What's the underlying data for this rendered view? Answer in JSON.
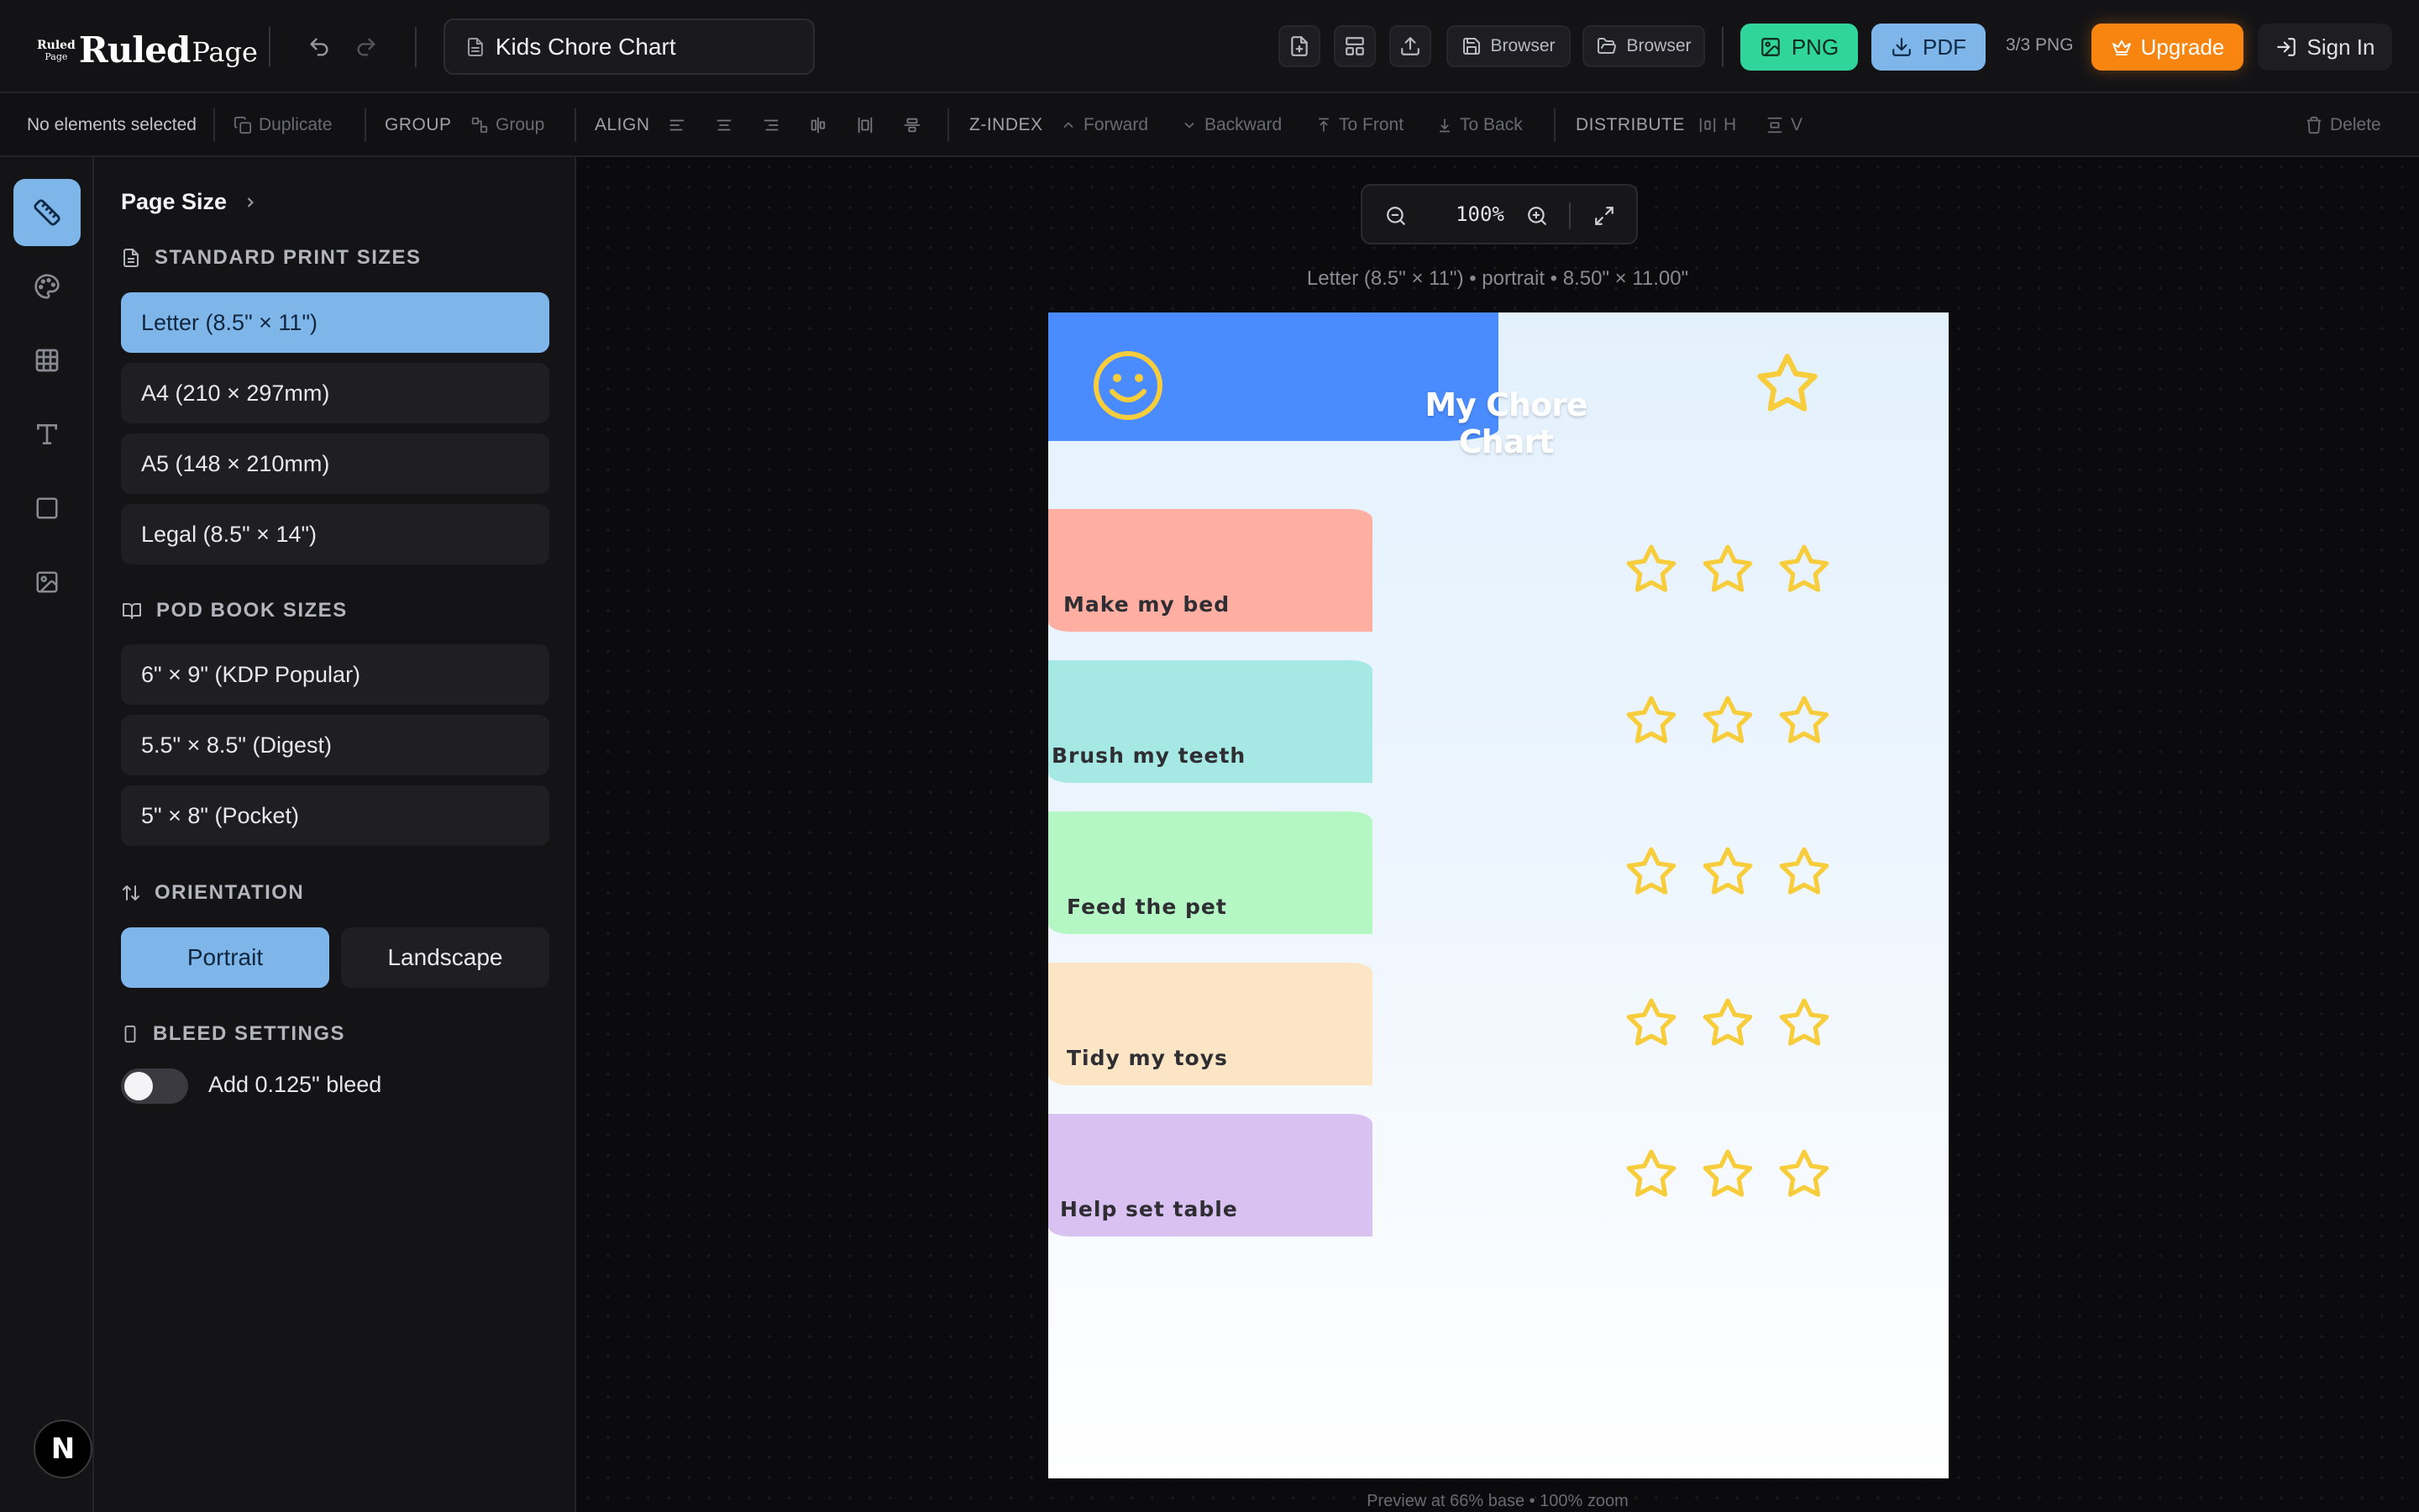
{
  "app": {
    "logo": {
      "mini_top": "Ruled",
      "mini_bottom": "Page",
      "main": "Ruled",
      "suffix": "Page"
    },
    "document_title": "Kids Chore Chart",
    "toolbar": {
      "save_browser_label": "Browser",
      "open_browser_label": "Browser",
      "png_label": "PNG",
      "pdf_label": "PDF",
      "png_count": "3/3 PNG",
      "upgrade_label": "Upgrade",
      "signin_label": "Sign In"
    },
    "colors": {
      "accent_blue": "#7fb6ea",
      "png_green": "#2fd59a",
      "upgrade_orange": "#f7850f"
    }
  },
  "edit_bar": {
    "status": "No elements selected",
    "duplicate": "Duplicate",
    "group_label": "GROUP",
    "group": "Group",
    "align_label": "ALIGN",
    "zindex_label": "Z-INDEX",
    "forward": "Forward",
    "backward": "Backward",
    "to_front": "To Front",
    "to_back": "To Back",
    "distribute_label": "DISTRIBUTE",
    "dist_h": "H",
    "dist_v": "V",
    "delete": "Delete"
  },
  "panel": {
    "title": "Page Size",
    "standard_heading": "STANDARD PRINT SIZES",
    "standard_sizes": [
      {
        "label": "Letter (8.5\" × 11\")",
        "selected": true
      },
      {
        "label": "A4 (210 × 297mm)",
        "selected": false
      },
      {
        "label": "A5 (148 × 210mm)",
        "selected": false
      },
      {
        "label": "Legal (8.5\" × 14\")",
        "selected": false
      }
    ],
    "pod_heading": "POD BOOK SIZES",
    "pod_sizes": [
      {
        "label": "6\" × 9\" (KDP Popular)"
      },
      {
        "label": "5.5\" × 8.5\" (Digest)"
      },
      {
        "label": "5\" × 8\" (Pocket)"
      }
    ],
    "orientation_heading": "ORIENTATION",
    "orientation": {
      "portrait": "Portrait",
      "landscape": "Landscape",
      "selected": "portrait"
    },
    "bleed_heading": "BLEED SETTINGS",
    "bleed_label": "Add 0.125\" bleed",
    "bleed_enabled": false
  },
  "canvas": {
    "zoom": "100%",
    "page_info": "Letter (8.5\" × 11\") • portrait • 8.50\" × 11.00\"",
    "preview_info": "Preview at 66% base • 100% zoom"
  },
  "chore_chart": {
    "title": "My Chore Chart",
    "stars_per_chore": 3,
    "chores": [
      {
        "label": "Make my bed",
        "color": "#ffafa2"
      },
      {
        "label": "Brush my teeth",
        "color": "#a6e8e4"
      },
      {
        "label": "Feed the pet",
        "color": "#b4f7c4"
      },
      {
        "label": "Tidy my toys",
        "color": "#fbe5c5"
      },
      {
        "label": "Help set table",
        "color": "#d9c1f2"
      }
    ],
    "header_color": "#4a8cff",
    "star_color": "#f7cd3c"
  }
}
